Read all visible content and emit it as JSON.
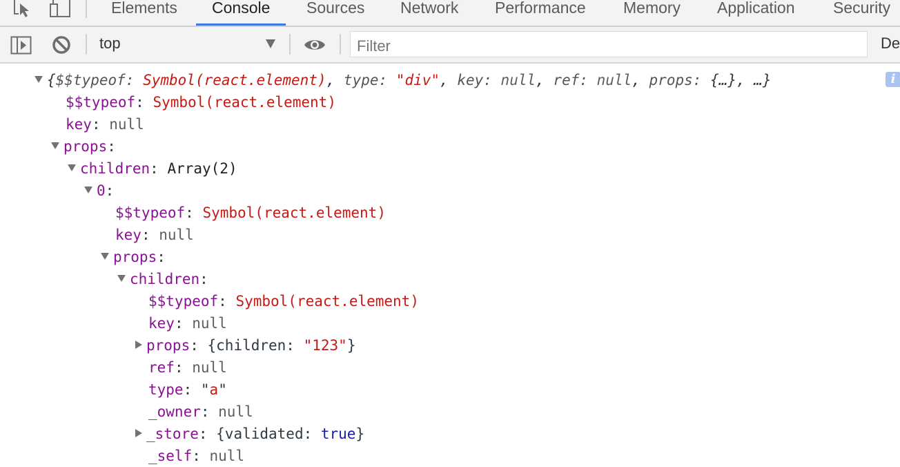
{
  "tabs": [
    {
      "label": "Elements",
      "active": false
    },
    {
      "label": "Console",
      "active": true
    },
    {
      "label": "Sources",
      "active": false
    },
    {
      "label": "Network",
      "active": false
    },
    {
      "label": "Performance",
      "active": false
    },
    {
      "label": "Memory",
      "active": false
    },
    {
      "label": "Application",
      "active": false
    },
    {
      "label": "Security",
      "active": false
    }
  ],
  "toolbar": {
    "context": "top",
    "filter_placeholder": "Filter",
    "levels_label": "De"
  },
  "console": {
    "summary": {
      "brace_open": "{",
      "k1": "$$typeof",
      "v1": "Symbol(react.element)",
      "k2": "type",
      "v2": "\"div\"",
      "k3": "key",
      "v3": "null",
      "k4": "ref",
      "v4": "null",
      "k5": "props",
      "v5": "{…}",
      "tail": "…}"
    },
    "lines": [
      {
        "key": "$$typeof",
        "value": "Symbol(react.element)"
      },
      {
        "key": "key",
        "value": "null"
      },
      {
        "key": "props",
        "value": ""
      },
      {
        "key": "children",
        "value": "Array(2)"
      },
      {
        "key": "0",
        "value": ""
      },
      {
        "key": "$$typeof",
        "value": "Symbol(react.element)"
      },
      {
        "key": "key",
        "value": "null"
      },
      {
        "key": "props",
        "value": ""
      },
      {
        "key": "children",
        "value": ""
      },
      {
        "key": "$$typeof",
        "value": "Symbol(react.element)"
      },
      {
        "key": "key",
        "value": "null"
      },
      {
        "key": "props",
        "value_pre": "{children: ",
        "value_str": "\"123\"",
        "value_post": "}"
      },
      {
        "key": "ref",
        "value": "null"
      },
      {
        "key": "type",
        "value_q1": "\"",
        "value_str": "a",
        "value_q2": "\""
      },
      {
        "key": "_owner",
        "value": "null"
      },
      {
        "key": "_store",
        "value_pre": "{validated: ",
        "value_bool": "true",
        "value_post": "}"
      },
      {
        "key": "_self",
        "value": "null"
      }
    ],
    "info_icon": "i"
  }
}
